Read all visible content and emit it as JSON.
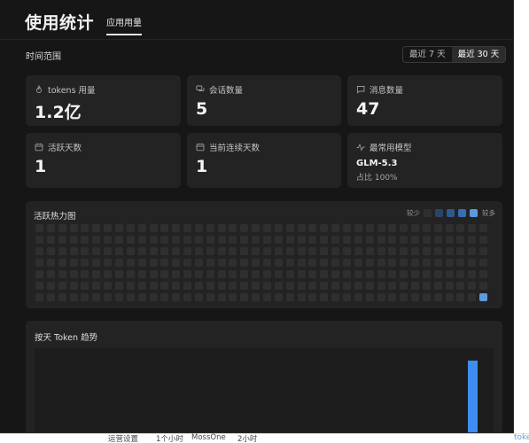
{
  "header": {
    "title": "使用统计",
    "tab": "应用用量"
  },
  "range": {
    "label": "时间范围",
    "options": [
      "最近 7 天",
      "最近 30 天"
    ],
    "selected": "最近 30 天"
  },
  "stats": {
    "tokens": {
      "label": "tokens 用量",
      "value": "1.2亿",
      "icon": "flame-icon"
    },
    "sessions": {
      "label": "会话数量",
      "value": "5",
      "icon": "chat-bubbles-icon"
    },
    "messages": {
      "label": "消息数量",
      "value": "47",
      "icon": "message-square-icon"
    },
    "active_days": {
      "label": "活跃天数",
      "value": "1",
      "icon": "calendar-icon"
    },
    "streak": {
      "label": "当前连续天数",
      "value": "1",
      "icon": "calendar-icon"
    },
    "top_model": {
      "label": "最常用模型",
      "model": "GLM-5.3",
      "share": "占比 100%",
      "icon": "activity-icon"
    }
  },
  "heatmap": {
    "title": "活跃热力图",
    "legend_less": "较少",
    "legend_more": "较多",
    "legend_colors": [
      "#2f2f2f",
      "#2b4466",
      "#2f5a8c",
      "#3670b4",
      "#5b9ae0"
    ],
    "empty_color": "#2f2f2f",
    "active_color": "#5b9ae0",
    "rows": 7,
    "cols": 40,
    "active_cells": [
      {
        "row": 6,
        "col": 39
      }
    ]
  },
  "trend": {
    "title": "按天 Token 趋势",
    "bar_color": "#3d8ef0",
    "days": 30,
    "values": [
      0,
      0,
      0,
      0,
      0,
      0,
      0,
      0,
      0,
      0,
      0,
      0,
      0,
      0,
      0,
      0,
      0,
      0,
      0,
      0,
      0,
      0,
      0,
      0,
      0,
      0,
      0,
      0,
      1,
      0
    ]
  },
  "background_strip": {
    "items": [
      "运营设置",
      "1个小时",
      "MossOne",
      "2小时"
    ],
    "right": "toke"
  }
}
